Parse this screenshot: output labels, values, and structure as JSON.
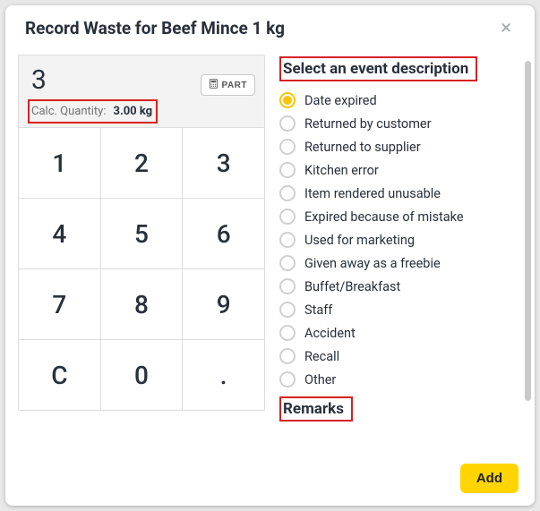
{
  "title": "Record Waste for Beef Mince 1 kg",
  "display": {
    "value": "3",
    "part_label": "PART",
    "calc_label": "Calc. Quantity:",
    "calc_value": "3.00 kg"
  },
  "keypad": [
    "1",
    "2",
    "3",
    "4",
    "5",
    "6",
    "7",
    "8",
    "9",
    "C",
    "0",
    "."
  ],
  "section_title": "Select an event description",
  "options": [
    {
      "label": "Date expired",
      "selected": true
    },
    {
      "label": "Returned by customer",
      "selected": false
    },
    {
      "label": "Returned to supplier",
      "selected": false
    },
    {
      "label": "Kitchen error",
      "selected": false
    },
    {
      "label": "Item rendered unusable",
      "selected": false
    },
    {
      "label": "Expired because of mistake",
      "selected": false
    },
    {
      "label": "Used for marketing",
      "selected": false
    },
    {
      "label": "Given away as a freebie",
      "selected": false
    },
    {
      "label": "Buffet/Breakfast",
      "selected": false
    },
    {
      "label": "Staff",
      "selected": false
    },
    {
      "label": "Accident",
      "selected": false
    },
    {
      "label": "Recall",
      "selected": false
    },
    {
      "label": "Other",
      "selected": false
    }
  ],
  "remarks_title": "Remarks",
  "add_label": "Add"
}
